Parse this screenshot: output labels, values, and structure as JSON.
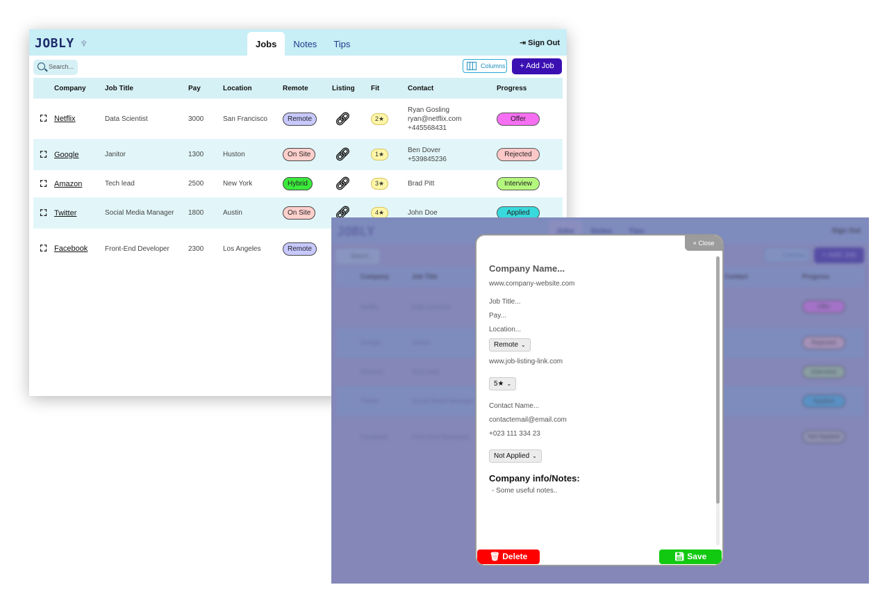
{
  "app": {
    "logo": "JOBLY",
    "tabs": [
      "Jobs",
      "Notes",
      "Tips"
    ],
    "sign_out": "Sign Out",
    "search_placeholder": "Search...",
    "columns_label": "Columns",
    "add_job_label": "+ Add Job"
  },
  "table": {
    "headers": [
      "Company",
      "Job Title",
      "Pay",
      "Location",
      "Remote",
      "Listing",
      "Fit",
      "Contact",
      "Progress"
    ],
    "rows": [
      {
        "company": "Netflix",
        "title": "Data Scientist",
        "pay": "3000",
        "location": "San Francisco",
        "remote": "Remote",
        "fit": "2★",
        "contact_lines": [
          "Ryan Gosling",
          "ryan@netflix.com",
          "+445568431"
        ],
        "progress": "Offer"
      },
      {
        "company": "Google",
        "title": "Janitor",
        "pay": "1300",
        "location": "Huston",
        "remote": "On Site",
        "fit": "1★",
        "contact_lines": [
          "Ben Dover",
          "+539845236"
        ],
        "progress": "Rejected"
      },
      {
        "company": "Amazon",
        "title": "Tech lead",
        "pay": "2500",
        "location": "New York",
        "remote": "Hybrid",
        "fit": "3★",
        "contact_lines": [
          "Brad Pitt"
        ],
        "progress": "Interview"
      },
      {
        "company": "Twitter",
        "title": "Social Media Manager",
        "pay": "1800",
        "location": "Austin",
        "remote": "On Site",
        "fit": "4★",
        "contact_lines": [
          "John Doe"
        ],
        "progress": "Applied"
      },
      {
        "company": "Facebook",
        "title": "Front-End Developer",
        "pay": "2300",
        "location": "Los Angeles",
        "remote": "Remote",
        "fit": "",
        "contact_lines": [],
        "progress": ""
      }
    ]
  },
  "modal": {
    "close_label": "× Close",
    "company_name": "Company Name...",
    "company_website": "www.company-website.com",
    "job_title": "Job Title...",
    "pay": "Pay...",
    "location": "Location...",
    "remote_select": "Remote",
    "listing_link": "www.job-listing-link.com",
    "fit_select": "5★",
    "contact_name": "Contact Name...",
    "contact_email": "contactemail@email.com",
    "contact_phone": "+023 111 334 23",
    "progress_select": "Not Applied",
    "notes_heading": "Company info/Notes:",
    "notes_text": "- Some useful notes..",
    "delete_label": "Delete",
    "save_label": "Save"
  },
  "background_view": {
    "companies": [
      "Netflix",
      "Google",
      "Amazon",
      "Twitter",
      "Facebook"
    ],
    "titles": [
      "Data Scientist",
      "Janitor",
      "Tech lead",
      "Social Media Manager",
      "Front End Developer"
    ],
    "progress": [
      "Offer",
      "Rejected",
      "Interview",
      "Applied",
      "Not Applied"
    ]
  },
  "colors": {
    "header_bg": "#c8eef6",
    "accent_purple": "#3b10b3",
    "overlay": "#8487b7",
    "delete_red": "#ff0000",
    "save_green": "#11c911"
  }
}
